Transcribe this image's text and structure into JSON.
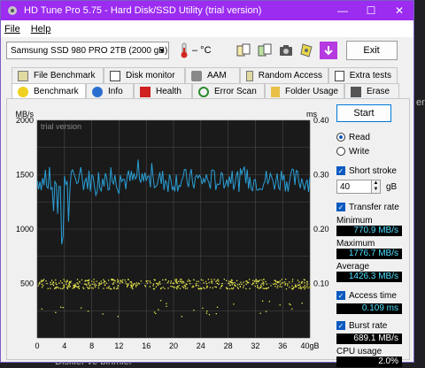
{
  "window": {
    "title": "HD Tune Pro 5.75 - Hard Disk/SSD Utility (trial version)",
    "controls": {
      "minimize": "—",
      "maximize": "☐",
      "close": "✕"
    }
  },
  "menu": [
    "File",
    "Help"
  ],
  "toolbar": {
    "drive": "Samsung SSD 980 PRO 2TB (2000 gB)",
    "temperature": "– °C",
    "exit_label": "Exit"
  },
  "tabs_top": [
    "File Benchmark",
    "Disk monitor",
    "AAM",
    "Random Access",
    "Extra tests"
  ],
  "tabs_bottom": [
    "Benchmark",
    "Info",
    "Health",
    "Error Scan",
    "Folder Usage",
    "Erase"
  ],
  "side": {
    "start_label": "Start",
    "read_label": "Read",
    "write_label": "Write",
    "short_stroke_label": "Short stroke",
    "short_stroke_value": "40",
    "short_stroke_unit": "gB",
    "transfer_rate_label": "Transfer rate",
    "minimum_label": "Minimum",
    "minimum_value": "770.9 MB/s",
    "maximum_label": "Maximum",
    "maximum_value": "1776.7 MB/s",
    "average_label": "Average",
    "average_value": "1426.3 MB/s",
    "access_time_label": "Access time",
    "access_time_value": "0.109 ms",
    "burst_rate_label": "Burst rate",
    "burst_rate_value": "689.1 MB/s",
    "cpu_usage_label": "CPU usage",
    "cpu_usage_value": "2.0%"
  },
  "background_text": {
    "bottom_left": "Diskler ve birimler",
    "right_fragment": "eri"
  },
  "chart_data": {
    "type": "line",
    "watermark": "trial version",
    "y_left_unit": "MB/s",
    "y_right_unit": "ms",
    "y_left_ticks": [
      "2000",
      "1500",
      "1000",
      "500"
    ],
    "y_right_ticks": [
      "0.40",
      "0.30",
      "0.20",
      "0.10"
    ],
    "x_ticks": [
      "0",
      "4",
      "8",
      "12",
      "16",
      "20",
      "24",
      "28",
      "32",
      "36",
      "40gB"
    ],
    "ylim_left": [
      0,
      2000
    ],
    "ylim_right": [
      0,
      0.4
    ],
    "xlim": [
      0,
      40
    ],
    "grid": true,
    "colors": {
      "transfer": "#2a9fd6",
      "access": "#e8e84a",
      "background": "#1a1a1a",
      "grid": "#4a4a4a"
    },
    "transfer_series_summary": {
      "name": "Transfer rate",
      "typical": 1450,
      "min": 770.9,
      "max": 1776.7
    },
    "access_series_summary": {
      "name": "Access time",
      "typical_ms": 0.1
    }
  }
}
